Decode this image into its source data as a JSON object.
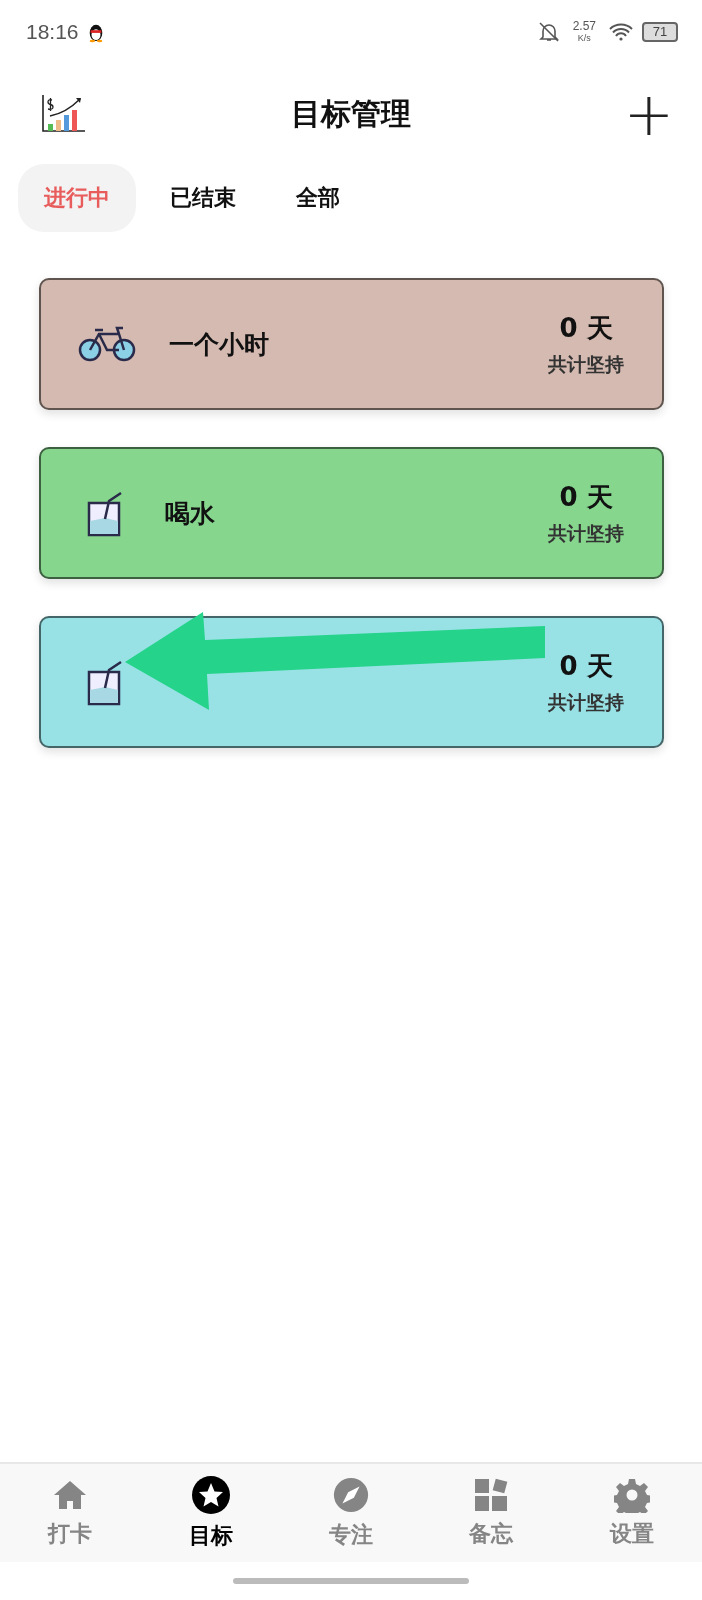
{
  "status_bar": {
    "time": "18:16",
    "speed": "2.57",
    "speed_unit": "K/s",
    "battery": "71"
  },
  "header": {
    "title": "目标管理",
    "add": "+"
  },
  "tabs": [
    {
      "label": "进行中",
      "selected": true
    },
    {
      "label": "已结束",
      "selected": false
    },
    {
      "label": "全部",
      "selected": false
    }
  ],
  "goals": [
    {
      "kind": "bicycle",
      "title": "一个小时",
      "days": "0 天",
      "caption": "共计坚持",
      "color": "#d4bab0"
    },
    {
      "kind": "cup",
      "title": "喝水",
      "days": "0 天",
      "caption": "共计坚持",
      "color": "#86d68e"
    },
    {
      "kind": "cup",
      "days": "0 天",
      "caption": "共计坚持",
      "color": "#98e2e6"
    }
  ],
  "nav": [
    {
      "kind": "home",
      "label": "打卡",
      "selected": false
    },
    {
      "kind": "star",
      "label": "目标",
      "selected": true
    },
    {
      "kind": "compass",
      "label": "专注",
      "selected": false
    },
    {
      "kind": "blocks",
      "label": "备忘",
      "selected": false
    },
    {
      "kind": "gear",
      "label": "设置",
      "selected": false
    }
  ]
}
